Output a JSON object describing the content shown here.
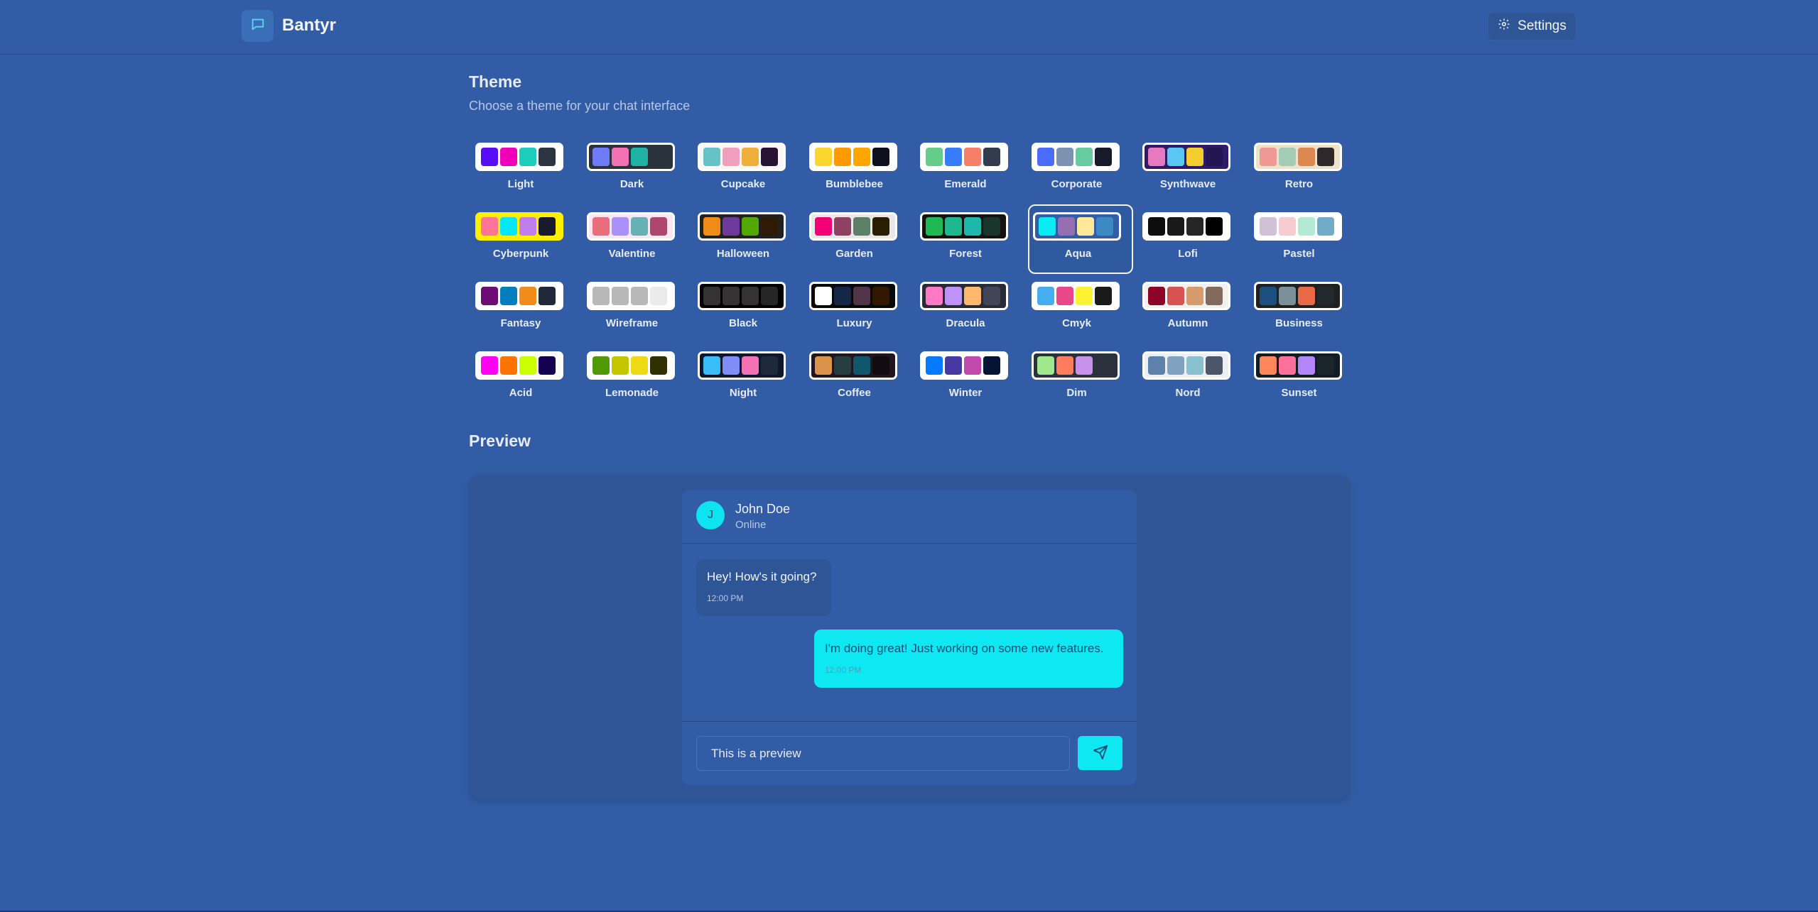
{
  "app": {
    "name": "Bantyr",
    "logo_icon": "chat-bubble-icon"
  },
  "header": {
    "settings_label": "Settings",
    "settings_icon": "gear-icon"
  },
  "theme_section": {
    "title": "Theme",
    "subtitle": "Choose a theme for your chat interface",
    "selected": "Aqua",
    "themes": [
      {
        "name": "Light",
        "colors": [
          "#570df8",
          "#f000b8",
          "#1dcdbc",
          "#2b3440"
        ],
        "frame": "#ffffff"
      },
      {
        "name": "Dark",
        "colors": [
          "#6f7bf7",
          "#f471b5",
          "#1fb2a5",
          "#2a323c"
        ],
        "frame": "#2a323c"
      },
      {
        "name": "Cupcake",
        "colors": [
          "#65c3c8",
          "#ef9fbc",
          "#eeaf3a",
          "#291334"
        ],
        "frame": "#faf7f5"
      },
      {
        "name": "Bumblebee",
        "colors": [
          "#f9d72f",
          "#ff9900",
          "#ffa500",
          "#0f0f1e"
        ],
        "frame": "#ffffff"
      },
      {
        "name": "Emerald",
        "colors": [
          "#66cc8a",
          "#377cfb",
          "#f68067",
          "#333c4d"
        ],
        "frame": "#ffffff"
      },
      {
        "name": "Corporate",
        "colors": [
          "#4b6bfb",
          "#7b92b2",
          "#67cba0",
          "#181a2a"
        ],
        "frame": "#ffffff"
      },
      {
        "name": "Synthwave",
        "colors": [
          "#e779c1",
          "#58c7f3",
          "#f3cc30",
          "#221551"
        ],
        "frame": "#2d1b69"
      },
      {
        "name": "Retro",
        "colors": [
          "#ef9995",
          "#a4cbb4",
          "#dc8850",
          "#2e282a"
        ],
        "frame": "#ece3ca"
      },
      {
        "name": "Cyberpunk",
        "colors": [
          "#ff7598",
          "#06e6ff",
          "#c07eec",
          "#1a1a2e"
        ],
        "frame": "#ffee00"
      },
      {
        "name": "Valentine",
        "colors": [
          "#e96d7b",
          "#a991f7",
          "#66b1b3",
          "#af4670"
        ],
        "frame": "#fae7f4"
      },
      {
        "name": "Halloween",
        "colors": [
          "#f28c18",
          "#6d3a9c",
          "#51a800",
          "#2f1b05"
        ],
        "frame": "#212121"
      },
      {
        "name": "Garden",
        "colors": [
          "#f40076",
          "#8e4162",
          "#5c7f67",
          "#291e00"
        ],
        "frame": "#e9e7e7"
      },
      {
        "name": "Forest",
        "colors": [
          "#1eb854",
          "#1db88e",
          "#1db8ab",
          "#19362d"
        ],
        "frame": "#171212"
      },
      {
        "name": "Aqua",
        "colors": [
          "#09ecf3",
          "#966fb3",
          "#ffe999",
          "#3b8ac4"
        ],
        "frame": "#345da7"
      },
      {
        "name": "Lofi",
        "colors": [
          "#0d0d0d",
          "#1a1919",
          "#262626",
          "#000000"
        ],
        "frame": "#ffffff"
      },
      {
        "name": "Pastel",
        "colors": [
          "#d1c1d7",
          "#f6cbd1",
          "#b4e9d6",
          "#70acc7"
        ],
        "frame": "#ffffff"
      },
      {
        "name": "Fantasy",
        "colors": [
          "#6e0b75",
          "#007ebd",
          "#f18c1b",
          "#1f2937"
        ],
        "frame": "#ffffff"
      },
      {
        "name": "Wireframe",
        "colors": [
          "#b8b8b8",
          "#b8b8b8",
          "#b8b8b8",
          "#ebebeb"
        ],
        "frame": "#ffffff"
      },
      {
        "name": "Black",
        "colors": [
          "#343232",
          "#343232",
          "#343232",
          "#272626"
        ],
        "frame": "#000000"
      },
      {
        "name": "Luxury",
        "colors": [
          "#ffffff",
          "#152747",
          "#513448",
          "#331800"
        ],
        "frame": "#09090b"
      },
      {
        "name": "Dracula",
        "colors": [
          "#ff79c6",
          "#bd93f9",
          "#ffb86c",
          "#414558"
        ],
        "frame": "#282a36"
      },
      {
        "name": "Cmyk",
        "colors": [
          "#45aeee",
          "#e8488a",
          "#fff232",
          "#1a1a1a"
        ],
        "frame": "#ffffff"
      },
      {
        "name": "Autumn",
        "colors": [
          "#8c0327",
          "#d85251",
          "#d59b6a",
          "#826a5c"
        ],
        "frame": "#f1f1f1"
      },
      {
        "name": "Business",
        "colors": [
          "#1c4e80",
          "#7c909a",
          "#ea6947",
          "#23282e"
        ],
        "frame": "#202020"
      },
      {
        "name": "Acid",
        "colors": [
          "#ff00f4",
          "#ff7400",
          "#cbfd03",
          "#140152"
        ],
        "frame": "#fafafa"
      },
      {
        "name": "Lemonade",
        "colors": [
          "#519903",
          "#c5c500",
          "#eeda14",
          "#313000"
        ],
        "frame": "#ffffff"
      },
      {
        "name": "Night",
        "colors": [
          "#38bdf8",
          "#818cf8",
          "#f471b5",
          "#1e293b"
        ],
        "frame": "#0f172a"
      },
      {
        "name": "Coffee",
        "colors": [
          "#db924b",
          "#263e3f",
          "#10576d",
          "#120c12"
        ],
        "frame": "#20161f"
      },
      {
        "name": "Winter",
        "colors": [
          "#047aff",
          "#463aa2",
          "#c148ac",
          "#021431"
        ],
        "frame": "#ffffff"
      },
      {
        "name": "Dim",
        "colors": [
          "#9fe88d",
          "#ff7d5c",
          "#c792e9",
          "#2a303c"
        ],
        "frame": "#2a303c"
      },
      {
        "name": "Nord",
        "colors": [
          "#5e81ac",
          "#81a1c1",
          "#88c0d0",
          "#4c566a"
        ],
        "frame": "#eceff4"
      },
      {
        "name": "Sunset",
        "colors": [
          "#ff865b",
          "#fd6f9c",
          "#b387fa",
          "#1b262c"
        ],
        "frame": "#121c22"
      }
    ]
  },
  "preview_section": {
    "title": "Preview",
    "contact": {
      "initial": "J",
      "name": "John Doe",
      "status": "Online"
    },
    "messages": [
      {
        "text": "Hey! How's it going?",
        "time": "12:00 PM",
        "direction": "incoming"
      },
      {
        "text": "I'm doing great! Just working on some new features.",
        "time": "12:00 PM",
        "direction": "outgoing"
      }
    ],
    "input": {
      "value": "This is a preview"
    },
    "send_icon": "send-icon"
  }
}
